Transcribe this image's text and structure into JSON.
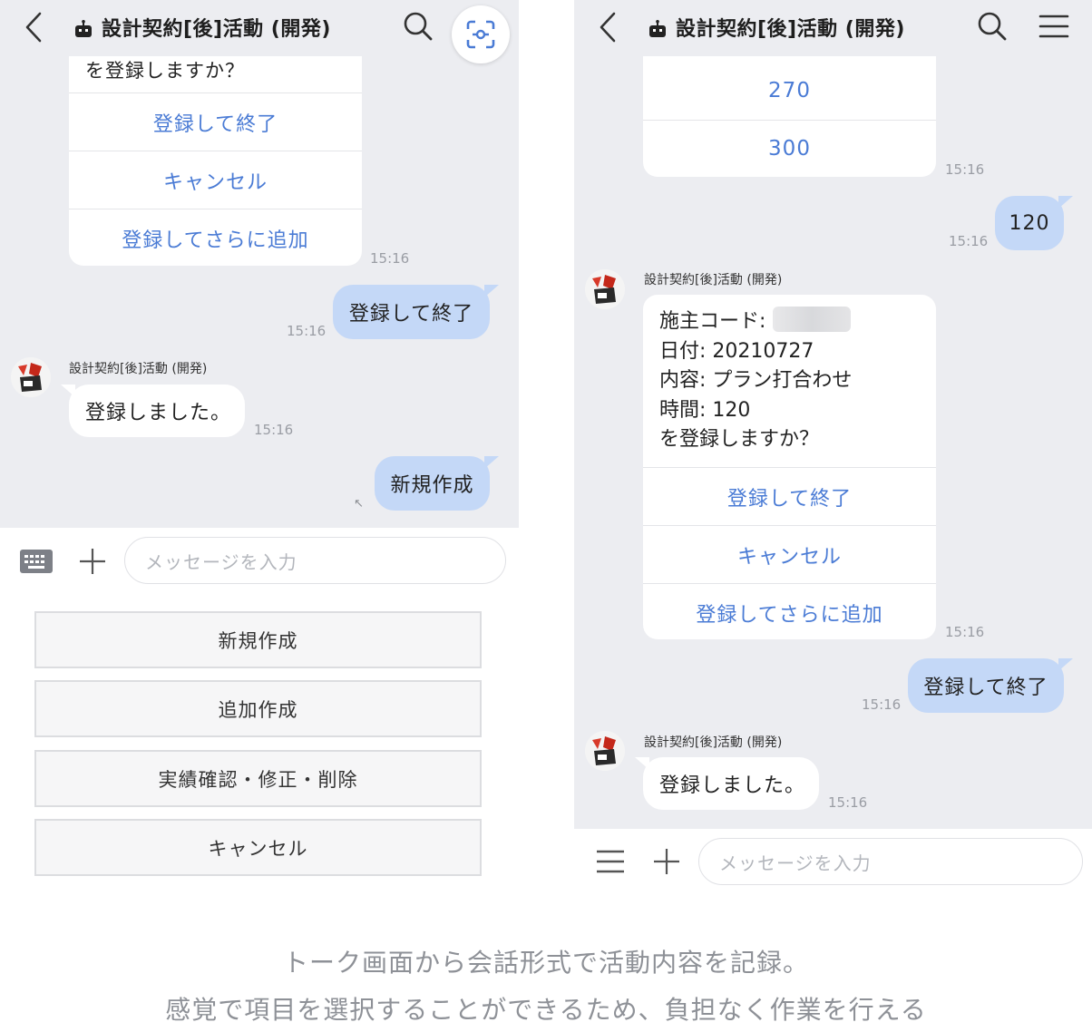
{
  "left": {
    "title": "設計契約[後]活動 (開発)",
    "card_tail_text": "を登録しますか？",
    "card_buttons": [
      "登録して終了",
      "キャンセル",
      "登録してさらに追加"
    ],
    "card_time": "15:16",
    "out1": {
      "text": "登録して終了",
      "time": "15:16"
    },
    "sender": "設計契約[後]活動 (開発)",
    "in1": {
      "text": "登録しました。",
      "time": "15:16"
    },
    "out2": {
      "text": "新規作成"
    },
    "input_placeholder": "メッセージを入力",
    "menu": [
      "新規作成",
      "追加作成",
      "実績確認・修正・削除",
      "キャンセル"
    ]
  },
  "right": {
    "title": "設計契約[後]活動 (開発)",
    "options": [
      "270",
      "300"
    ],
    "options_time": "15:16",
    "out1": {
      "text": "120",
      "time": "15:16"
    },
    "sender1": "設計契約[後]活動 (開発)",
    "confirm": {
      "line1_label": "施主コード:",
      "line2": "日付: 20210727",
      "line3": "内容: プラン打合わせ",
      "line4": "時間: 120",
      "line5": "を登録しますか？",
      "buttons": [
        "登録して終了",
        "キャンセル",
        "登録してさらに追加"
      ],
      "time": "15:16"
    },
    "out2": {
      "text": "登録して終了",
      "time": "15:16"
    },
    "sender2": "設計契約[後]活動 (開発)",
    "in1": {
      "text": "登録しました。",
      "time": "15:16"
    },
    "input_placeholder": "メッセージを入力"
  },
  "caption": {
    "line1": "トーク画面から会話形式で活動内容を記録。",
    "line2": "感覚で項目を選択することができるため、負担なく作業を行える"
  },
  "colors": {
    "accent_link": "#4a7bd5",
    "outgoing_bubble": "#c4d8f7",
    "chat_bg": "#ecedf1"
  },
  "icons": [
    "back-arrow-icon",
    "bot-icon",
    "search-icon",
    "scan-icon",
    "menu-icon",
    "keyboard-icon",
    "plus-icon",
    "resize-arrow-icon",
    "avatar-icon"
  ]
}
